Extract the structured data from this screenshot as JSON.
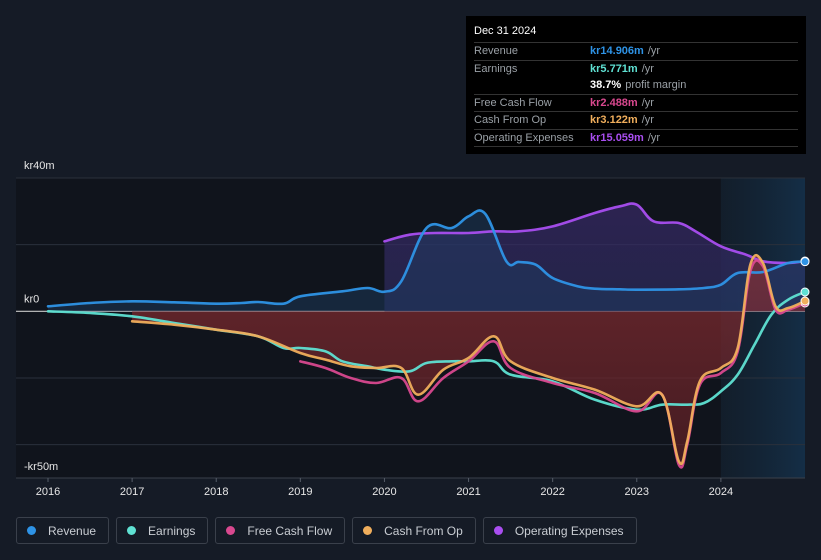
{
  "tooltip": {
    "date": "Dec 31 2024",
    "rows": [
      {
        "label": "Revenue",
        "value": "kr14.906m",
        "unit": "/yr",
        "color": "#2e93e6"
      },
      {
        "label": "Earnings",
        "value": "kr5.771m",
        "unit": "/yr",
        "color": "#5fe1d3"
      },
      {
        "label": "",
        "value": "38.7%",
        "unit": "profit margin",
        "color": "#ffffff"
      },
      {
        "label": "Free Cash Flow",
        "value": "kr2.488m",
        "unit": "/yr",
        "color": "#d9488f"
      },
      {
        "label": "Cash From Op",
        "value": "kr3.122m",
        "unit": "/yr",
        "color": "#f0ae5c"
      },
      {
        "label": "Operating Expenses",
        "value": "kr15.059m",
        "unit": "/yr",
        "color": "#a94ef0"
      }
    ]
  },
  "legend": [
    {
      "label": "Revenue",
      "color": "#2e93e6"
    },
    {
      "label": "Earnings",
      "color": "#5fe1d3"
    },
    {
      "label": "Free Cash Flow",
      "color": "#d9488f"
    },
    {
      "label": "Cash From Op",
      "color": "#f0ae5c"
    },
    {
      "label": "Operating Expenses",
      "color": "#a94ef0"
    }
  ],
  "chart_data": {
    "type": "line",
    "title": "",
    "xlabel": "",
    "ylabel": "",
    "y_tick_labels": [
      "kr40m",
      "kr0",
      "-kr50m"
    ],
    "x_tick_labels": [
      "2016",
      "2017",
      "2018",
      "2019",
      "2020",
      "2021",
      "2022",
      "2023",
      "2024"
    ],
    "xlim": [
      2016,
      2025
    ],
    "ylim": [
      -50,
      40
    ],
    "units": "kr millions",
    "grid": true,
    "legend_position": "bottom",
    "forecast_region_start": 2024,
    "series": [
      {
        "name": "Revenue",
        "color": "#2e93e6",
        "x": [
          2016.0,
          2016.5,
          2017.0,
          2017.5,
          2018.0,
          2018.3,
          2018.5,
          2018.8,
          2019.0,
          2019.5,
          2019.8,
          2020.0,
          2020.2,
          2020.5,
          2020.8,
          2021.0,
          2021.2,
          2021.45,
          2021.6,
          2021.8,
          2022.0,
          2022.3,
          2022.5,
          2022.8,
          2023.0,
          2023.5,
          2023.8,
          2024.0,
          2024.2,
          2024.5,
          2024.8,
          2025.0
        ],
        "values": [
          1.5,
          2.5,
          3.0,
          2.7,
          2.3,
          2.5,
          2.8,
          2.3,
          4.5,
          6.0,
          7.0,
          5.9,
          9.0,
          25.0,
          25.0,
          28.5,
          29.2,
          15.0,
          14.8,
          14.0,
          10.0,
          7.5,
          6.8,
          6.6,
          6.5,
          6.6,
          7.0,
          8.0,
          11.5,
          11.8,
          14.5,
          14.9
        ]
      },
      {
        "name": "Earnings",
        "color": "#5fe1d3",
        "x": [
          2016.0,
          2016.5,
          2017.0,
          2017.5,
          2018.0,
          2018.5,
          2018.8,
          2019.0,
          2019.3,
          2019.5,
          2019.8,
          2020.0,
          2020.3,
          2020.5,
          2020.8,
          2021.0,
          2021.3,
          2021.5,
          2022.0,
          2022.5,
          2023.0,
          2023.3,
          2023.6,
          2023.8,
          2024.0,
          2024.2,
          2024.4,
          2024.6,
          2024.8,
          2025.0
        ],
        "values": [
          0.0,
          -0.5,
          -1.5,
          -3.5,
          -5.5,
          -7.5,
          -11.0,
          -11.0,
          -12.0,
          -15.0,
          -16.5,
          -17.5,
          -18.0,
          -15.5,
          -15.0,
          -15.0,
          -15.0,
          -19.0,
          -21.0,
          -26.5,
          -29.5,
          -28.0,
          -28.0,
          -27.5,
          -24.0,
          -19.0,
          -10.0,
          -1.0,
          3.5,
          5.8
        ]
      },
      {
        "name": "Free Cash Flow",
        "color": "#d9488f",
        "x": [
          2019.0,
          2019.3,
          2019.6,
          2019.9,
          2020.2,
          2020.4,
          2020.7,
          2021.0,
          2021.3,
          2021.5,
          2022.0,
          2022.5,
          2023.0,
          2023.3,
          2023.5,
          2023.6,
          2023.75,
          2024.0,
          2024.2,
          2024.35,
          2024.5,
          2024.65,
          2024.8,
          2025.0
        ],
        "values": [
          -15.0,
          -17.0,
          -20.0,
          -21.5,
          -20.0,
          -27.0,
          -20.0,
          -15.0,
          -9.0,
          -17.0,
          -21.5,
          -24.5,
          -30.0,
          -25.0,
          -46.0,
          -40.0,
          -22.0,
          -18.5,
          -12.0,
          12.0,
          13.5,
          0.5,
          0.5,
          2.5
        ]
      },
      {
        "name": "Cash From Op",
        "color": "#f0ae5c",
        "x": [
          2017.0,
          2017.5,
          2018.0,
          2018.5,
          2019.0,
          2019.3,
          2019.6,
          2019.9,
          2020.2,
          2020.4,
          2020.7,
          2021.0,
          2021.3,
          2021.5,
          2022.0,
          2022.5,
          2023.0,
          2023.3,
          2023.5,
          2023.6,
          2023.75,
          2024.0,
          2024.2,
          2024.35,
          2024.5,
          2024.65,
          2024.8,
          2025.0
        ],
        "values": [
          -3.0,
          -4.0,
          -5.5,
          -7.5,
          -12.5,
          -14.5,
          -16.5,
          -17.0,
          -17.0,
          -25.0,
          -17.5,
          -14.0,
          -7.5,
          -15.0,
          -20.0,
          -23.5,
          -28.5,
          -25.0,
          -45.0,
          -39.0,
          -21.0,
          -17.0,
          -11.0,
          14.0,
          14.5,
          1.5,
          1.0,
          3.1
        ]
      },
      {
        "name": "Operating Expenses",
        "color": "#a94ef0",
        "x": [
          2020.0,
          2020.3,
          2020.6,
          2021.0,
          2021.3,
          2021.6,
          2022.0,
          2022.5,
          2022.8,
          2023.0,
          2023.2,
          2023.5,
          2023.7,
          2024.0,
          2024.3,
          2024.5,
          2024.8,
          2025.0
        ],
        "values": [
          21.0,
          23.0,
          23.5,
          23.5,
          24.0,
          24.0,
          25.5,
          29.5,
          31.5,
          32.0,
          27.0,
          26.5,
          24.0,
          19.5,
          17.0,
          15.0,
          14.5,
          15.1
        ]
      }
    ]
  }
}
